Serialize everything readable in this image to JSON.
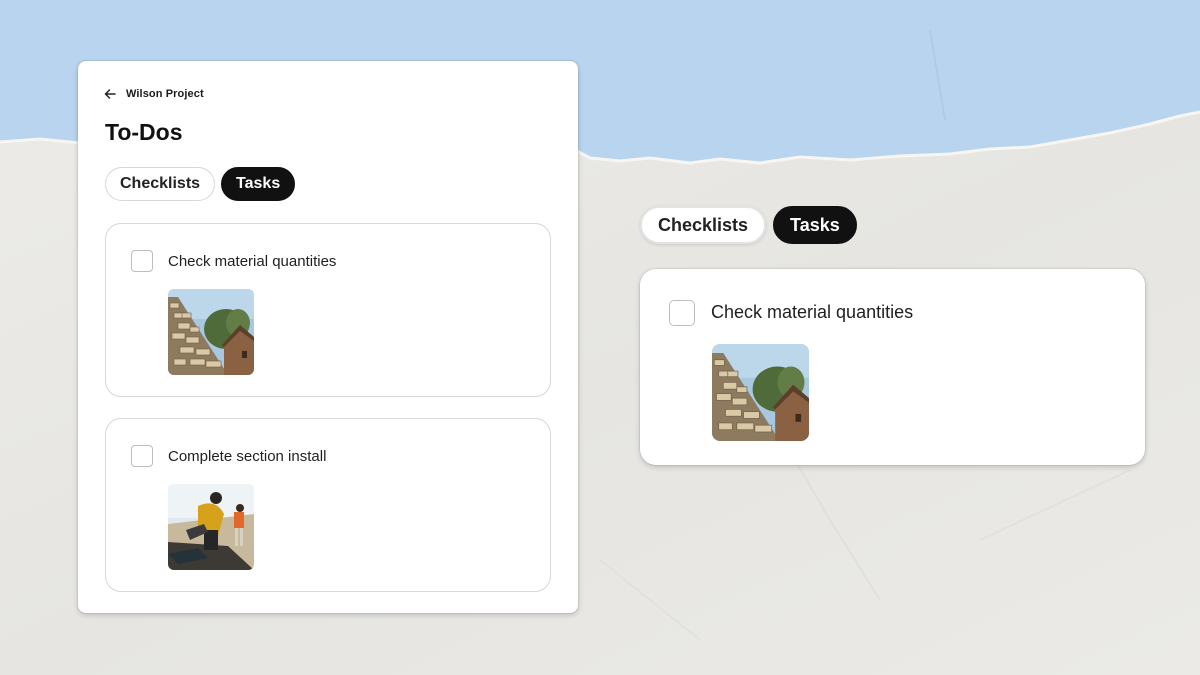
{
  "background": {
    "sky_color": "#b8d4ef",
    "paper_color": "#e9e8e4"
  },
  "main_card": {
    "back_label": "Wilson Project",
    "title": "To-Dos",
    "tabs": [
      {
        "label": "Checklists",
        "active": false
      },
      {
        "label": "Tasks",
        "active": true
      }
    ],
    "tasks": [
      {
        "label": "Check material quantities",
        "checked": false,
        "photo": "roof-shingles-photo"
      },
      {
        "label": "Complete section install",
        "checked": false,
        "photo": "roofers-working-photo"
      }
    ]
  },
  "zoom_panel": {
    "tabs": [
      {
        "label": "Checklists",
        "active": false
      },
      {
        "label": "Tasks",
        "active": true
      }
    ],
    "task": {
      "label": "Check material quantities",
      "checked": false,
      "photo": "roof-shingles-photo"
    }
  }
}
